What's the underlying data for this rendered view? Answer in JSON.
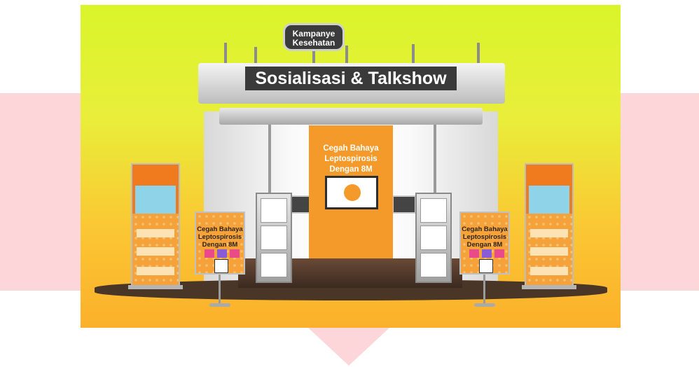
{
  "booth": {
    "small_sign": "Kampanye Kesehatan",
    "roof_title": "Sosialisasi & Talkshow",
    "center_title": "Cegah Bahaya Leptospirosis Dengan 8M",
    "banner_left_title": "Cegah Bahaya Leptospirosis Dengan 8M",
    "banner_right_title": "Cegah Bahaya Leptospirosis Dengan 8M"
  },
  "colors": {
    "sky_top": "#d9f52a",
    "sky_bottom": "#fbb02b",
    "accent_orange": "#f39a2b",
    "ribbon_pink": "#fcd6d8",
    "sign_dark": "#3a3a3a"
  }
}
